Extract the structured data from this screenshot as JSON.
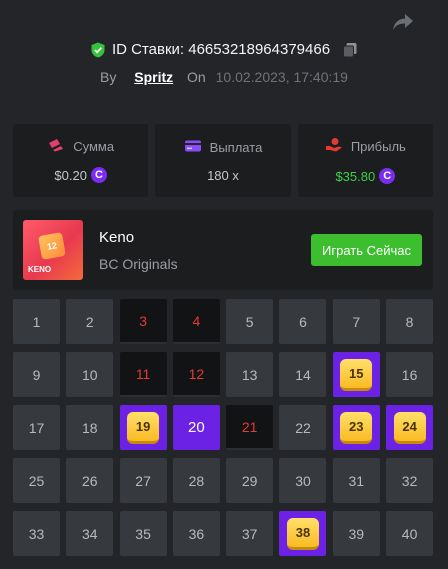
{
  "header": {
    "bet_id_label": "ID Ставки: 46653218964379466",
    "by_label": "By",
    "username": "Spritz",
    "on_label": "On",
    "datetime": "10.02.2023, 17:40:19"
  },
  "stats": [
    {
      "label": "Сумма",
      "value": "$0.20",
      "icon": "coins-icon",
      "color": "#e33f6a"
    },
    {
      "label": "Выплата",
      "value": "180 x",
      "icon": "card-icon",
      "color": "#8a4dfb"
    },
    {
      "label": "Прибыль",
      "value": "$35.80",
      "icon": "hand-coin-icon",
      "color": "#e53935"
    }
  ],
  "coin_symbol": "C",
  "game": {
    "title": "Keno",
    "subtitle": "BC Originals",
    "thumb_label": "KENO",
    "thumb_number": "12",
    "play_label": "Играть Сейчас"
  },
  "colors": {
    "accent_purple": "#6c22e4",
    "play_green": "#3cbe2f",
    "profit_green": "#3fd04a",
    "drawn_red": "#e53935",
    "gem_yellow": "#f9bb23"
  },
  "grid": {
    "numbers": [
      "1",
      "2",
      "3",
      "4",
      "5",
      "6",
      "7",
      "8",
      "9",
      "10",
      "11",
      "12",
      "13",
      "14",
      "15",
      "16",
      "17",
      "18",
      "19",
      "20",
      "21",
      "22",
      "23",
      "24",
      "25",
      "26",
      "27",
      "28",
      "29",
      "30",
      "31",
      "32",
      "33",
      "34",
      "35",
      "36",
      "37",
      "38",
      "39",
      "40"
    ],
    "drawn_misses": [
      3,
      4,
      11,
      12,
      21
    ],
    "picked_misses": [
      20
    ],
    "hits": [
      15,
      19,
      23,
      24,
      38
    ]
  }
}
